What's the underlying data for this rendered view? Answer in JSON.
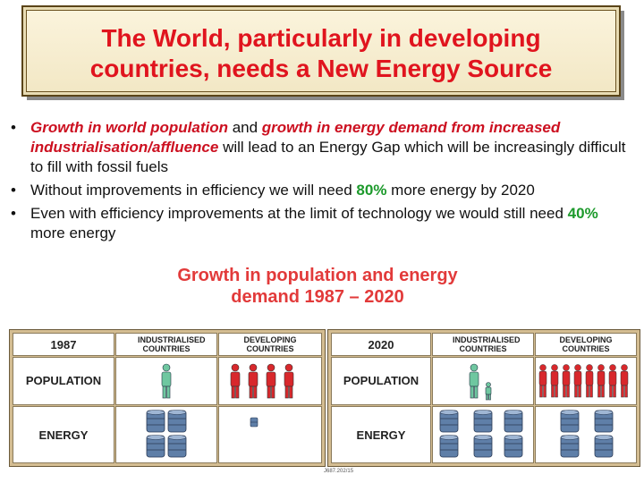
{
  "title": {
    "line1": "The World, particularly in developing",
    "line2": "countries, needs a New Energy Source"
  },
  "bullets": [
    {
      "seg1": "Growth in world population",
      "seg2": " and ",
      "seg3": "growth in energy demand from increased industrialisation/affluence",
      "seg4": " will lead to an Energy Gap which will be increasingly difficult to fill with fossil fuels"
    },
    {
      "seg1": "Without improvements in efficiency we will need ",
      "seg2": "80%",
      "seg3": " more energy by 2020"
    },
    {
      "seg1": "Even with efficiency improvements at the limit of technology we would still need ",
      "seg2": "40%",
      "seg3": " more energy"
    }
  ],
  "bullet_char": "•",
  "chart_caption": {
    "line1": "Growth in population and energy",
    "line2": "demand 1987 – 2020"
  },
  "panels": [
    {
      "year": "1987",
      "col1": "INDUSTRIALISED COUNTRIES",
      "col2": "DEVELOPING COUNTRIES",
      "population_label": "POPULATION",
      "energy_label": "ENERGY"
    },
    {
      "year": "2020",
      "col1": "INDUSTRIALISED COUNTRIES",
      "col2": "DEVELOPING COUNTRIES",
      "population_label": "POPULATION",
      "energy_label": "ENERGY"
    }
  ],
  "footnote": "J687.202/15",
  "colors": {
    "title_red": "#e0141e",
    "highlight_red": "#cc1020",
    "highlight_green": "#1d9a2c",
    "caption_red": "#e23a3a",
    "panel_tan": "#d4bd92",
    "person_industrialised": "#6fc7a0",
    "person_developing": "#d8282c",
    "barrel": "#5f7fa8"
  }
}
